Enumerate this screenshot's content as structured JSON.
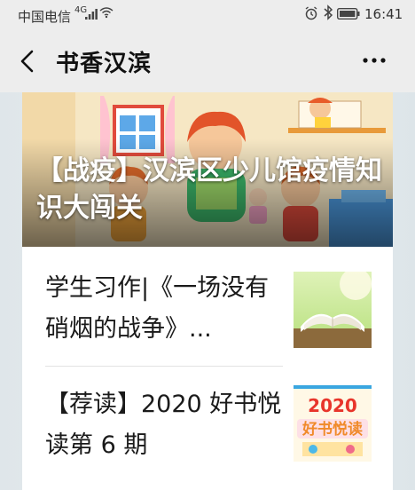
{
  "status_bar": {
    "carrier": "中国电信",
    "signal_label": "4G",
    "time": "16:41",
    "icons": [
      "signal-icon",
      "wifi-icon",
      "alarm-icon",
      "bluetooth-icon",
      "battery-icon"
    ]
  },
  "nav": {
    "title": "书香汉滨",
    "back_icon": "chevron-left-icon",
    "more_icon": "more-horizontal-icon"
  },
  "articles": {
    "hero": {
      "title": "【战疫】汉滨区少儿馆疫情知识大闯关"
    },
    "items": [
      {
        "title": "学生习作|《一场没有硝烟的战争》..."
      },
      {
        "title": "【荐读】2020 好书悦读第 6 期",
        "thumb_text": "2020",
        "thumb_subtext": "好书悦读"
      }
    ]
  },
  "colors": {
    "bar_bg": "#ededed",
    "thumb_text_red": "#e8352b",
    "hero_wall": "#f6e7c4"
  }
}
